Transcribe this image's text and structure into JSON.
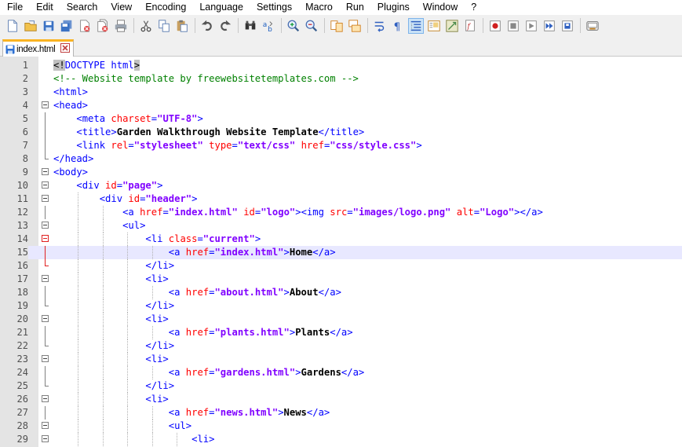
{
  "menu": [
    "File",
    "Edit",
    "Search",
    "View",
    "Encoding",
    "Language",
    "Settings",
    "Macro",
    "Run",
    "Plugins",
    "Window",
    "?"
  ],
  "toolbar": [
    "new-file-icon",
    "open-file-icon",
    "save-icon",
    "save-all-icon",
    "close-icon",
    "close-all-icon",
    "print-icon",
    "|",
    "cut-icon",
    "copy-icon",
    "paste-icon",
    "|",
    "undo-icon",
    "redo-icon",
    "|",
    "find-icon",
    "replace-icon",
    "|",
    "zoom-in-icon",
    "zoom-out-icon",
    "|",
    "sync-vertical-icon",
    "sync-horizontal-icon",
    "|",
    "word-wrap-icon",
    "show-all-characters-icon",
    "indent-guide-icon",
    "document-map-icon",
    "function-list-icon",
    "folder-workspace-icon",
    "|",
    "record-macro-icon",
    "stop-recording-icon",
    "play-macro-icon",
    "run-macro-multiple-icon",
    "save-macro-icon",
    "|",
    "launch-in-browser-icon"
  ],
  "tab": {
    "label": "index.html"
  },
  "editor": {
    "highlight_line": 15,
    "lines": [
      {
        "n": "1",
        "indent": 0,
        "fold": "",
        "segs": [
          [
            "dt",
            "<!"
          ],
          [
            "t",
            "DOCTYPE html"
          ],
          [
            "dt",
            ">"
          ]
        ]
      },
      {
        "n": "2",
        "indent": 0,
        "fold": "",
        "segs": [
          [
            "c",
            "<!-- Website template by freewebsitetemplates.com -->"
          ]
        ]
      },
      {
        "n": "3",
        "indent": 0,
        "fold": "",
        "segs": [
          [
            "t",
            "<html>"
          ]
        ]
      },
      {
        "n": "4",
        "indent": 0,
        "fold": "box",
        "segs": [
          [
            "t",
            "<head>"
          ]
        ]
      },
      {
        "n": "5",
        "indent": 1,
        "fold": "line",
        "segs": [
          [
            "t",
            "<meta "
          ],
          [
            "a",
            "charset"
          ],
          [
            "t",
            "="
          ],
          [
            "v",
            "\"UTF-8\""
          ],
          [
            "t",
            ">"
          ]
        ]
      },
      {
        "n": "6",
        "indent": 1,
        "fold": "line",
        "segs": [
          [
            "t",
            "<title>"
          ],
          [
            "x",
            "Garden Walkthrough Website Template"
          ],
          [
            "t",
            "</title>"
          ]
        ]
      },
      {
        "n": "7",
        "indent": 1,
        "fold": "line",
        "segs": [
          [
            "t",
            "<link "
          ],
          [
            "a",
            "rel"
          ],
          [
            "t",
            "="
          ],
          [
            "v",
            "\"stylesheet\""
          ],
          [
            "t",
            " "
          ],
          [
            "a",
            "type"
          ],
          [
            "t",
            "="
          ],
          [
            "v",
            "\"text/css\""
          ],
          [
            "t",
            " "
          ],
          [
            "a",
            "href"
          ],
          [
            "t",
            "="
          ],
          [
            "v",
            "\"css/style.css\""
          ],
          [
            "t",
            ">"
          ]
        ]
      },
      {
        "n": "8",
        "indent": 0,
        "fold": "end",
        "segs": [
          [
            "t",
            "</head>"
          ]
        ]
      },
      {
        "n": "9",
        "indent": 0,
        "fold": "box",
        "segs": [
          [
            "t",
            "<body>"
          ]
        ]
      },
      {
        "n": "10",
        "indent": 1,
        "fold": "box",
        "segs": [
          [
            "t",
            "<div "
          ],
          [
            "a",
            "id"
          ],
          [
            "t",
            "="
          ],
          [
            "v",
            "\"page\""
          ],
          [
            "t",
            ">"
          ]
        ]
      },
      {
        "n": "11",
        "indent": 2,
        "fold": "box",
        "segs": [
          [
            "t",
            "<div "
          ],
          [
            "a",
            "id"
          ],
          [
            "t",
            "="
          ],
          [
            "v",
            "\"header\""
          ],
          [
            "t",
            ">"
          ]
        ]
      },
      {
        "n": "12",
        "indent": 3,
        "fold": "line",
        "segs": [
          [
            "t",
            "<a "
          ],
          [
            "a",
            "href"
          ],
          [
            "t",
            "="
          ],
          [
            "v",
            "\"index.html\""
          ],
          [
            "t",
            " "
          ],
          [
            "a",
            "id"
          ],
          [
            "t",
            "="
          ],
          [
            "v",
            "\"logo\""
          ],
          [
            "t",
            "><img "
          ],
          [
            "a",
            "src"
          ],
          [
            "t",
            "="
          ],
          [
            "v",
            "\"images/logo.png\""
          ],
          [
            "t",
            " "
          ],
          [
            "a",
            "alt"
          ],
          [
            "t",
            "="
          ],
          [
            "v",
            "\"Logo\""
          ],
          [
            "t",
            "></a>"
          ]
        ]
      },
      {
        "n": "13",
        "indent": 3,
        "fold": "box",
        "segs": [
          [
            "t",
            "<ul>"
          ]
        ]
      },
      {
        "n": "14",
        "indent": 4,
        "fold": "boxred",
        "segs": [
          [
            "t",
            "<li "
          ],
          [
            "a",
            "class"
          ],
          [
            "t",
            "="
          ],
          [
            "v",
            "\"current\""
          ],
          [
            "t",
            ">"
          ]
        ]
      },
      {
        "n": "15",
        "indent": 5,
        "fold": "linered",
        "segs": [
          [
            "t",
            "<a "
          ],
          [
            "a",
            "href"
          ],
          [
            "t",
            "="
          ],
          [
            "v",
            "\"index.html\""
          ],
          [
            "t",
            ">"
          ],
          [
            "x",
            "Home"
          ],
          [
            "t",
            "</a>"
          ]
        ]
      },
      {
        "n": "16",
        "indent": 4,
        "fold": "endred",
        "segs": [
          [
            "t",
            "</li>"
          ]
        ]
      },
      {
        "n": "17",
        "indent": 4,
        "fold": "box",
        "segs": [
          [
            "t",
            "<li>"
          ]
        ]
      },
      {
        "n": "18",
        "indent": 5,
        "fold": "line",
        "segs": [
          [
            "t",
            "<a "
          ],
          [
            "a",
            "href"
          ],
          [
            "t",
            "="
          ],
          [
            "v",
            "\"about.html\""
          ],
          [
            "t",
            ">"
          ],
          [
            "x",
            "About"
          ],
          [
            "t",
            "</a>"
          ]
        ]
      },
      {
        "n": "19",
        "indent": 4,
        "fold": "end",
        "segs": [
          [
            "t",
            "</li>"
          ]
        ]
      },
      {
        "n": "20",
        "indent": 4,
        "fold": "box",
        "segs": [
          [
            "t",
            "<li>"
          ]
        ]
      },
      {
        "n": "21",
        "indent": 5,
        "fold": "line",
        "segs": [
          [
            "t",
            "<a "
          ],
          [
            "a",
            "href"
          ],
          [
            "t",
            "="
          ],
          [
            "v",
            "\"plants.html\""
          ],
          [
            "t",
            ">"
          ],
          [
            "x",
            "Plants"
          ],
          [
            "t",
            "</a>"
          ]
        ]
      },
      {
        "n": "22",
        "indent": 4,
        "fold": "end",
        "segs": [
          [
            "t",
            "</li>"
          ]
        ]
      },
      {
        "n": "23",
        "indent": 4,
        "fold": "box",
        "segs": [
          [
            "t",
            "<li>"
          ]
        ]
      },
      {
        "n": "24",
        "indent": 5,
        "fold": "line",
        "segs": [
          [
            "t",
            "<a "
          ],
          [
            "a",
            "href"
          ],
          [
            "t",
            "="
          ],
          [
            "v",
            "\"gardens.html\""
          ],
          [
            "t",
            ">"
          ],
          [
            "x",
            "Gardens"
          ],
          [
            "t",
            "</a>"
          ]
        ]
      },
      {
        "n": "25",
        "indent": 4,
        "fold": "end",
        "segs": [
          [
            "t",
            "</li>"
          ]
        ]
      },
      {
        "n": "26",
        "indent": 4,
        "fold": "box",
        "segs": [
          [
            "t",
            "<li>"
          ]
        ]
      },
      {
        "n": "27",
        "indent": 5,
        "fold": "line",
        "segs": [
          [
            "t",
            "<a "
          ],
          [
            "a",
            "href"
          ],
          [
            "t",
            "="
          ],
          [
            "v",
            "\"news.html\""
          ],
          [
            "t",
            ">"
          ],
          [
            "x",
            "News"
          ],
          [
            "t",
            "</a>"
          ]
        ]
      },
      {
        "n": "28",
        "indent": 5,
        "fold": "box",
        "segs": [
          [
            "t",
            "<ul>"
          ]
        ]
      },
      {
        "n": "29",
        "indent": 6,
        "fold": "box",
        "segs": [
          [
            "t",
            "<li>"
          ]
        ]
      }
    ]
  }
}
